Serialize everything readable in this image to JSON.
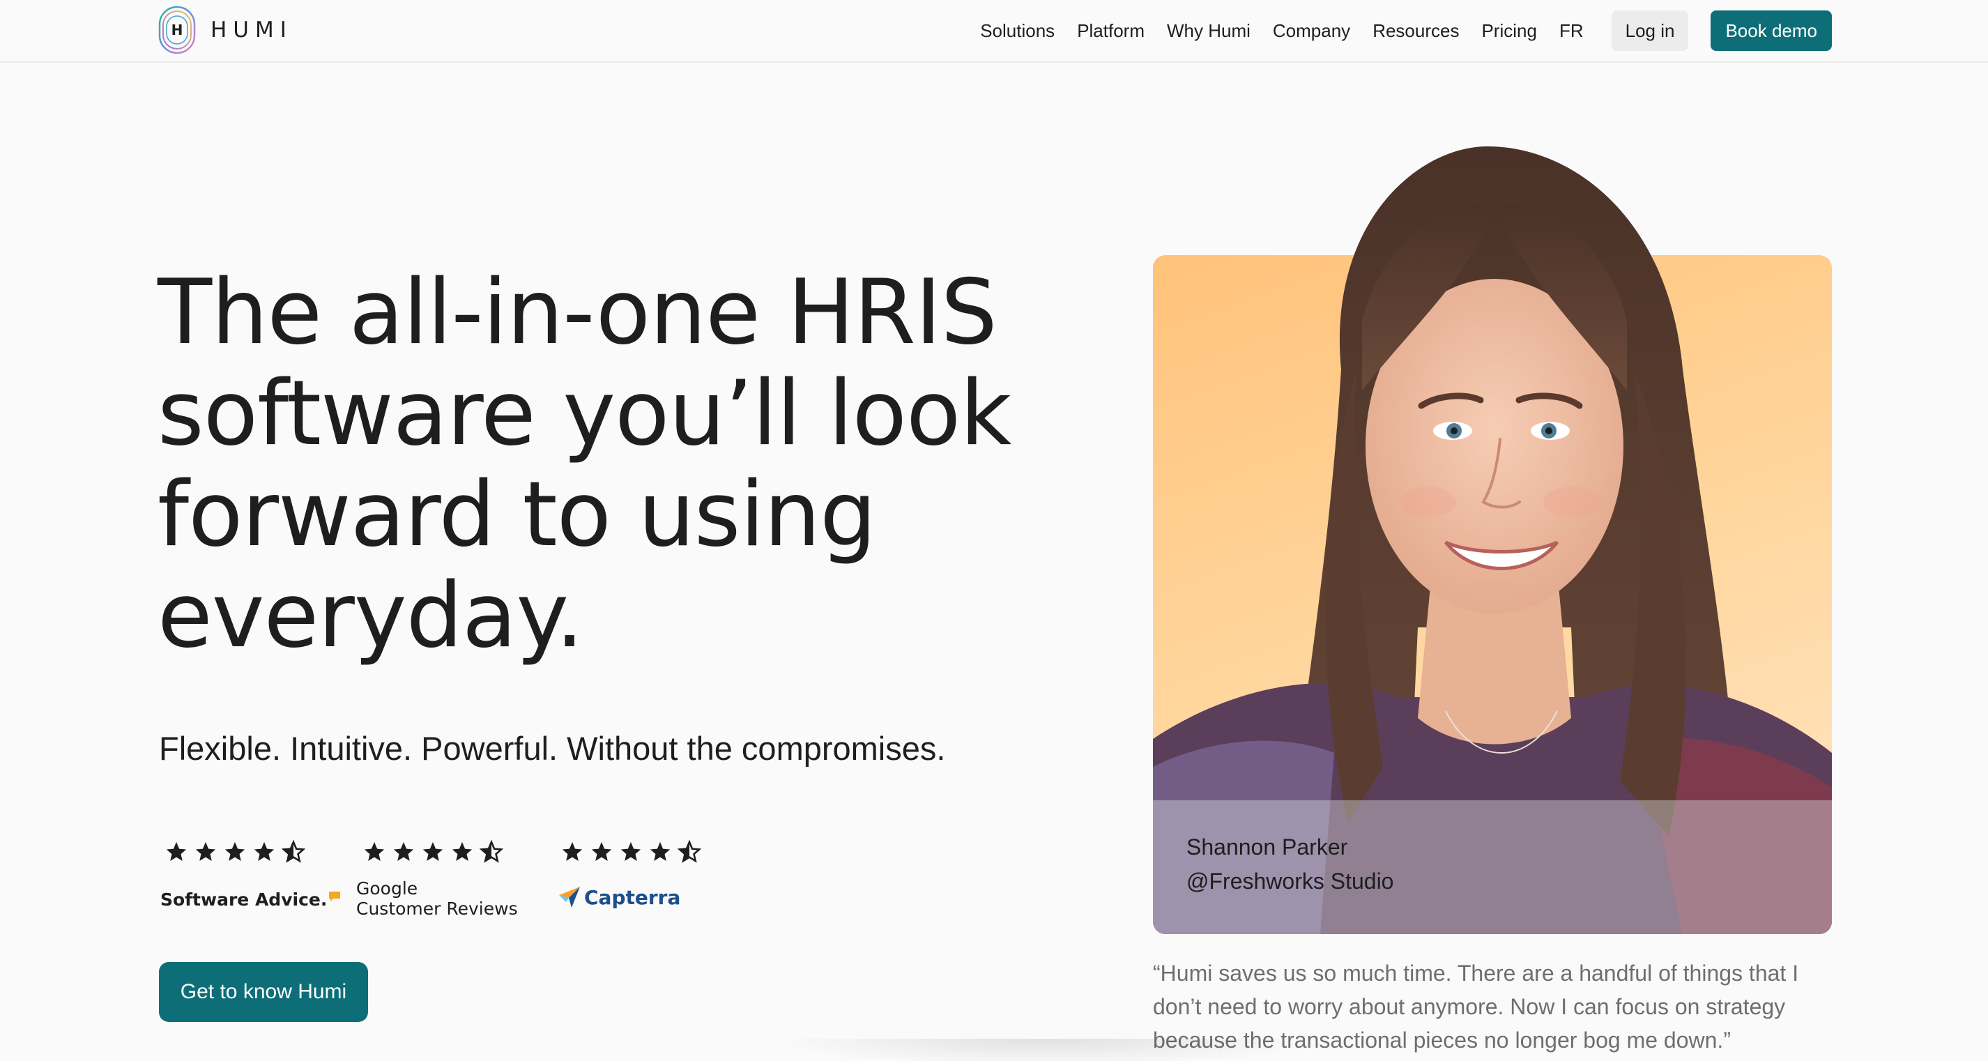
{
  "brand": {
    "name": "HUMI",
    "logo_letter": "H"
  },
  "nav": {
    "items": [
      "Solutions",
      "Platform",
      "Why Humi",
      "Company",
      "Resources",
      "Pricing",
      "FR"
    ],
    "login_label": "Log in",
    "demo_label": "Book demo"
  },
  "hero": {
    "headline_lines": [
      "The all-in-one HRIS",
      "software you’ll look",
      "forward to using",
      "everyday."
    ],
    "subheadline": "Flexible. Intuitive. Powerful. Without the compromises.",
    "cta_label": "Get to know Humi"
  },
  "ratings": [
    {
      "stars": 4.5,
      "source": "Software Advice."
    },
    {
      "stars": 4.5,
      "source_lines": [
        "Google",
        "Customer Reviews"
      ]
    },
    {
      "stars": 4.5,
      "source": "Capterra"
    }
  ],
  "testimonial": {
    "name": "Shannon Parker",
    "handle": "@Freshworks Studio",
    "quote": "“Humi saves us so much time. There are a handful of things that I don’t need to worry about anymore. Now I can focus on strategy because the transactional pieces no longer bog me down.”"
  },
  "colors": {
    "accent": "#0d6e78",
    "text": "#1e1e1e",
    "background": "#fafafa",
    "card_gradient": "#ffc27a",
    "quote_text": "#6e6e6e"
  },
  "icons": {
    "star": "star-icon",
    "half_star": "half-star-icon",
    "logo": "humi-logo-icon",
    "capterra": "capterra-arrow-icon"
  }
}
